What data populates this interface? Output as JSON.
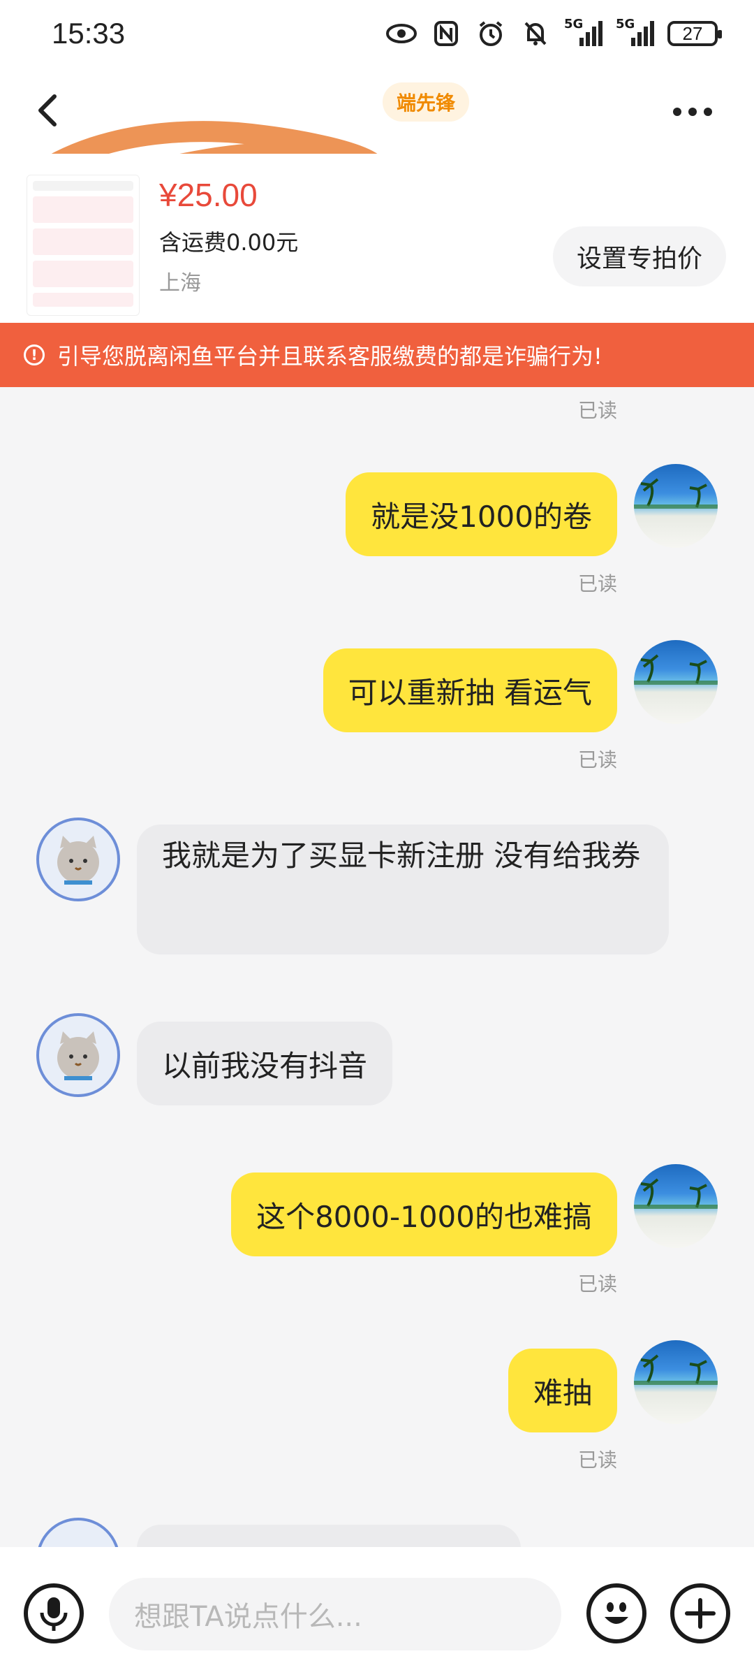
{
  "status_bar": {
    "time": "15:33",
    "network_1": "5G",
    "network_2": "5G",
    "battery": "27",
    "icons": [
      "eye-icon",
      "nfc-icon",
      "alarm-icon",
      "mute-icon",
      "signal-icon",
      "signal-icon",
      "battery-icon"
    ]
  },
  "header": {
    "tag": "端先锋"
  },
  "product": {
    "price": "¥25.00",
    "shipping": "含运费0.00元",
    "location": "上海",
    "set_price_label": "设置专拍价"
  },
  "warning": {
    "text": "引导您脱离闲鱼平台并且联系客服缴费的都是诈骗行为!"
  },
  "messages": [
    {
      "sender": "me",
      "text": "就是没1000的卷",
      "read": "已读"
    },
    {
      "sender": "me",
      "text": "可以重新抽 看运气",
      "read": "已读"
    },
    {
      "sender": "them",
      "text": "我就是为了买显卡新注册 没有给我券"
    },
    {
      "sender": "them",
      "text": "以前我没有抖音"
    },
    {
      "sender": "me",
      "text": "这个8000-1000的也难搞",
      "read": "已读"
    },
    {
      "sender": "me",
      "text": "难抽",
      "read": "已读"
    }
  ],
  "top_read": "已读",
  "input": {
    "placeholder": "想跟TA说点什么..."
  },
  "colors": {
    "my_bubble": "#ffe53d",
    "their_bubble": "#ebebed",
    "warning_bg": "#f0603e",
    "price": "#e8493a"
  }
}
